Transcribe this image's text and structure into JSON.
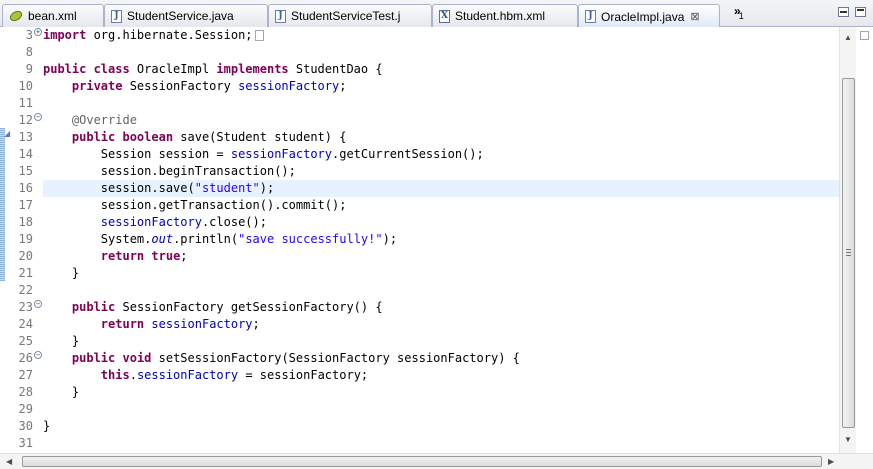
{
  "tabs": [
    {
      "label": "bean.xml",
      "icon": "bean-xml-icon",
      "active": false
    },
    {
      "label": "StudentService.java",
      "icon": "java-file-icon",
      "active": false
    },
    {
      "label": "StudentServiceTest.j",
      "icon": "java-file-icon",
      "active": false
    },
    {
      "label": "Student.hbm.xml",
      "icon": "xml-file-icon",
      "active": false
    },
    {
      "label": "OracleImpl.java",
      "icon": "java-file-icon",
      "active": true
    }
  ],
  "tab_close_glyph": "⊠",
  "overflow": {
    "chevron": "»",
    "count": "1"
  },
  "editor": {
    "file": "OracleImpl.java",
    "lines": [
      {
        "n": "3"
      },
      {
        "n": "8"
      },
      {
        "n": "9"
      },
      {
        "n": "10"
      },
      {
        "n": "11"
      },
      {
        "n": "12"
      },
      {
        "n": "13"
      },
      {
        "n": "14"
      },
      {
        "n": "15"
      },
      {
        "n": "16"
      },
      {
        "n": "17"
      },
      {
        "n": "18"
      },
      {
        "n": "19"
      },
      {
        "n": "20"
      },
      {
        "n": "21"
      },
      {
        "n": "22"
      },
      {
        "n": "23"
      },
      {
        "n": "24"
      },
      {
        "n": "25"
      },
      {
        "n": "26"
      },
      {
        "n": "27"
      },
      {
        "n": "28"
      },
      {
        "n": "29"
      },
      {
        "n": "30"
      },
      {
        "n": "31"
      }
    ],
    "code": {
      "l3_kw": "import",
      "l3_rest": " org.hibernate.Session;",
      "l9_kw1": "public class",
      "l9_mid": " OracleImpl ",
      "l9_kw2": "implements",
      "l9_rest": " StudentDao {",
      "l10_kw": "private",
      "l10_mid": " SessionFactory ",
      "l10_fld": "sessionFactory",
      "l10_end": ";",
      "l12_ann": "@Override",
      "l13_kw": "public boolean",
      "l13_rest": " save(Student student) {",
      "l14_pre": "Session session = ",
      "l14_fld": "sessionFactory",
      "l14_rest": ".getCurrentSession();",
      "l15": "session.beginTransaction();",
      "l16_pre": "session.save(",
      "l16_str": "\"student\"",
      "l16_end": ");",
      "l17": "session.getTransaction().commit();",
      "l18_fld": "sessionFactory",
      "l18_rest": ".close();",
      "l19_pre": "System.",
      "l19_fld": "out",
      "l19_mid": ".println(",
      "l19_str": "\"save successfully!\"",
      "l19_end": ");",
      "l20_kw1": "return",
      "l20_sp": " ",
      "l20_kw2": "true",
      "l20_end": ";",
      "brace": "}",
      "l23_kw": "public",
      "l23_rest": " SessionFactory getSessionFactory() {",
      "l24_kw": "return",
      "l24_sp": " ",
      "l24_fld": "sessionFactory",
      "l24_end": ";",
      "l26_kw1": "public",
      "l26_sp": " ",
      "l26_kw2": "void",
      "l26_rest": " setSessionFactory(SessionFactory sessionFactory) {",
      "l27_kw": "this",
      "l27_dot": ".",
      "l27_fld": "sessionFactory",
      "l27_rest": " = sessionFactory;"
    }
  },
  "fold_plus": "+",
  "fold_minus": "−",
  "scroll": {
    "up": "▲",
    "down": "▼",
    "left": "◀",
    "right": "▶"
  },
  "colors": {
    "keyword": "#7f0055",
    "field": "#0000c0",
    "string": "#2a00ff",
    "annotation": "#646464",
    "current_line": "#e8f2fe"
  }
}
